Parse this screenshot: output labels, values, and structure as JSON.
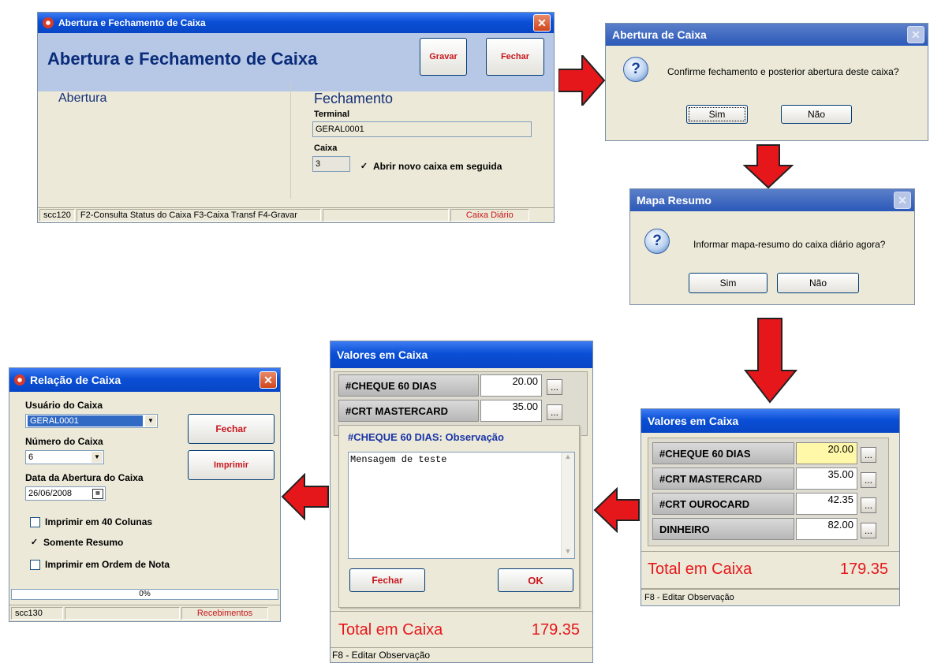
{
  "win1": {
    "title": "Abertura e Fechamento de Caixa",
    "header": "Abertura e Fechamento de Caixa",
    "gravar": "Gravar",
    "fechar": "Fechar",
    "abertura": "Abertura",
    "fechamento": "Fechamento",
    "terminal_label": "Terminal",
    "terminal_value": "GERAL0001",
    "caixa_label": "Caixa",
    "caixa_value": "3",
    "abrir_novo": "Abrir novo caixa em seguida",
    "abrir_novo_checked": true,
    "status": [
      "scc120",
      "F2-Consulta Status do Caixa  F3-Caixa Transf  F4-Gravar",
      "",
      "Caixa Diário"
    ]
  },
  "dlg1": {
    "title": "Abertura de Caixa",
    "message": "Confirme fechamento e posterior abertura deste caixa?",
    "sim": "Sim",
    "nao": "Não"
  },
  "dlg2": {
    "title": "Mapa Resumo",
    "message": "Informar mapa-resumo do caixa diário agora?",
    "sim": "Sim",
    "nao": "Não"
  },
  "valores_right": {
    "title": "Valores em Caixa",
    "rows": [
      {
        "label": "#CHEQUE 60 DIAS",
        "value": "20.00"
      },
      {
        "label": "#CRT MASTERCARD",
        "value": "35.00"
      },
      {
        "label": "#CRT OUROCARD",
        "value": "42.35"
      },
      {
        "label": "DINHEIRO",
        "value": "82.00"
      }
    ],
    "ellipsis": "...",
    "total_label": "Total em Caixa",
    "total_value": "179.35",
    "status": "F8 - Editar Observação"
  },
  "valores_mid": {
    "title": "Valores em Caixa",
    "rows": [
      {
        "label": "#CHEQUE 60 DIAS",
        "value": "20.00"
      },
      {
        "label": "#CRT MASTERCARD",
        "value": "35.00"
      }
    ],
    "ellipsis": "...",
    "obs_title": "#CHEQUE 60 DIAS: Observação",
    "obs_text": "Mensagem de teste",
    "fechar": "Fechar",
    "ok": "OK",
    "total_label": "Total em Caixa",
    "total_value": "179.35",
    "status": "F8 - Editar Observação"
  },
  "relacao": {
    "title": "Relação de Caixa",
    "usuario_label": "Usuário do Caixa",
    "usuario_value": "GERAL0001",
    "numero_label": "Número do Caixa",
    "numero_value": "6",
    "data_label": "Data da Abertura do Caixa",
    "data_value": "26/06/2008",
    "fechar": "Fechar",
    "imprimir": "Imprimir",
    "opt1": "Imprimir em 40 Colunas",
    "opt1_checked": false,
    "opt2": "Somente Resumo",
    "opt2_checked": true,
    "opt3": "Imprimir em Ordem de Nota",
    "opt3_checked": false,
    "progress": 0,
    "progress_text": "0%",
    "status": [
      "scc130",
      "",
      "Recebimentos"
    ]
  },
  "colors": {
    "arrow": "#e6171b",
    "title_blue": "#0a4fd6",
    "accent_red": "#c8161d"
  }
}
